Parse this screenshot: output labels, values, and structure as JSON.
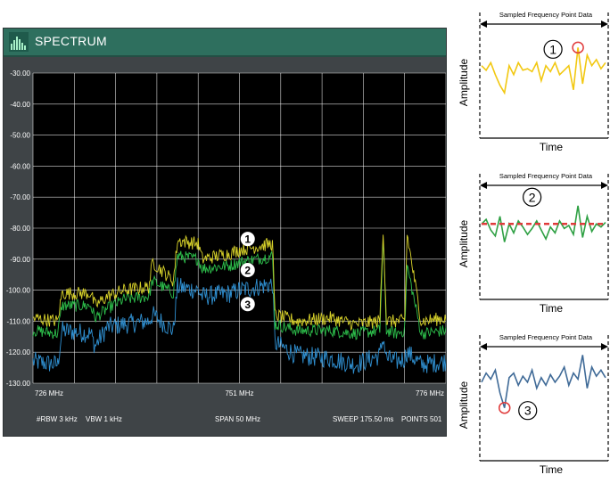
{
  "window": {
    "title": "SPECTRUM"
  },
  "status_bar": {
    "rbw": "#RBW 3 kHz",
    "vbw": "VBW 1 kHz",
    "span": "SPAN 50 MHz",
    "sweep": "SWEEP",
    "sweep_time": "175.50 ms",
    "points": "POINTS 501"
  },
  "marker_labels": [
    "1",
    "2",
    "3"
  ],
  "chart_data": [
    {
      "type": "line",
      "title": "",
      "xlabel": "",
      "ylabel": "",
      "ylim": [
        -130,
        -30
      ],
      "xlim": [
        726,
        776
      ],
      "grid": true,
      "y_ticks": [
        "-30.00",
        "-40.00",
        "-50.00",
        "-60.00",
        "-70.00",
        "-80.00",
        "-90.00",
        "-100.00",
        "-110.00",
        "-120.00",
        "-130.00"
      ],
      "x_ticks": [
        "726 MHz",
        "751 MHz",
        "776 MHz"
      ],
      "colors": {
        "1": "#d8d22a",
        "2": "#2dbf4b",
        "3": "#2f8fd0",
        "grid": "#ffffff"
      },
      "series": [
        {
          "name": "1",
          "color": "#d8d22a",
          "x": [
            726,
            729,
            729.5,
            733,
            733.5,
            735,
            737,
            740,
            740.5,
            743,
            743.5,
            746,
            746.5,
            750,
            751,
            755,
            755.3,
            758,
            762,
            765,
            768,
            768.4,
            768.8,
            770,
            771,
            771.3,
            773,
            776
          ],
          "values": [
            -109,
            -110,
            -101,
            -101,
            -105,
            -102,
            -100,
            -99,
            -91,
            -97,
            -84,
            -85,
            -90,
            -88,
            -87,
            -85,
            -108,
            -110,
            -109,
            -111,
            -110,
            -80,
            -110,
            -110,
            -110,
            -82,
            -110,
            -109
          ]
        },
        {
          "name": "2",
          "color": "#2dbf4b",
          "x": [
            726,
            729,
            729.5,
            733,
            733.5,
            735,
            737,
            740,
            740.5,
            743,
            743.5,
            746,
            746.5,
            750,
            751,
            755,
            755.3,
            758,
            762,
            765,
            768,
            768.4,
            768.8,
            770,
            771,
            771.3,
            773,
            776
          ],
          "values": [
            -113,
            -114,
            -105,
            -105,
            -109,
            -106,
            -103,
            -102,
            -97,
            -101,
            -89,
            -90,
            -93,
            -92,
            -91,
            -89,
            -111,
            -113,
            -113,
            -114,
            -113,
            -84,
            -113,
            -114,
            -113,
            -92,
            -114,
            -113
          ]
        },
        {
          "name": "3",
          "color": "#2f8fd0",
          "x": [
            726,
            729,
            729.5,
            733,
            733.5,
            735,
            737,
            740,
            740.5,
            743,
            743.5,
            746,
            746.5,
            750,
            751,
            755,
            755.3,
            758,
            762,
            765,
            768,
            768.4,
            768.8,
            770,
            771,
            771.3,
            773,
            776
          ],
          "values": [
            -123,
            -124,
            -113,
            -114,
            -118,
            -112,
            -111,
            -110,
            -108,
            -113,
            -99,
            -100,
            -102,
            -101,
            -100,
            -98,
            -117,
            -121,
            -122,
            -124,
            -121,
            -115,
            -122,
            -123,
            -122,
            -120,
            -124,
            -123
          ]
        }
      ]
    },
    {
      "type": "line",
      "title": "Sampled Frequency Point Data",
      "xlabel": "Time",
      "ylabel": "Amplitude",
      "series": [
        {
          "name": "",
          "color": "#f2c811",
          "values": [
            48,
            45,
            50,
            42,
            35,
            30,
            48,
            42,
            50,
            45,
            46,
            44,
            50,
            38,
            48,
            44,
            50,
            42,
            45,
            48,
            32,
            60,
            36,
            55,
            48,
            52,
            46,
            50
          ]
        }
      ],
      "annotation": {
        "label": "1",
        "marker": "max"
      }
    },
    {
      "type": "line",
      "title": "Sampled Frequency Point Data",
      "xlabel": "Time",
      "ylabel": "Amplitude",
      "series": [
        {
          "name": "",
          "color": "#2ea043",
          "values": [
            50,
            53,
            46,
            42,
            55,
            38,
            50,
            44,
            52,
            48,
            43,
            47,
            52,
            46,
            40,
            48,
            44,
            52,
            47,
            49,
            43,
            62,
            41,
            55,
            45,
            50,
            48,
            51
          ]
        }
      ],
      "reference_line": {
        "value": 50,
        "color": "#e03b3b",
        "style": "dashed"
      },
      "annotation": {
        "label": "2",
        "marker": "mean"
      }
    },
    {
      "type": "line",
      "title": "Sampled Frequency Point Data",
      "xlabel": "Time",
      "ylabel": "Amplitude",
      "series": [
        {
          "name": "",
          "color": "#3f6a97",
          "values": [
            52,
            58,
            54,
            60,
            45,
            35,
            55,
            58,
            50,
            56,
            52,
            60,
            48,
            55,
            50,
            57,
            52,
            56,
            62,
            50,
            58,
            54,
            70,
            48,
            62,
            56,
            60,
            55
          ]
        }
      ],
      "annotation": {
        "label": "3",
        "marker": "min"
      }
    }
  ]
}
